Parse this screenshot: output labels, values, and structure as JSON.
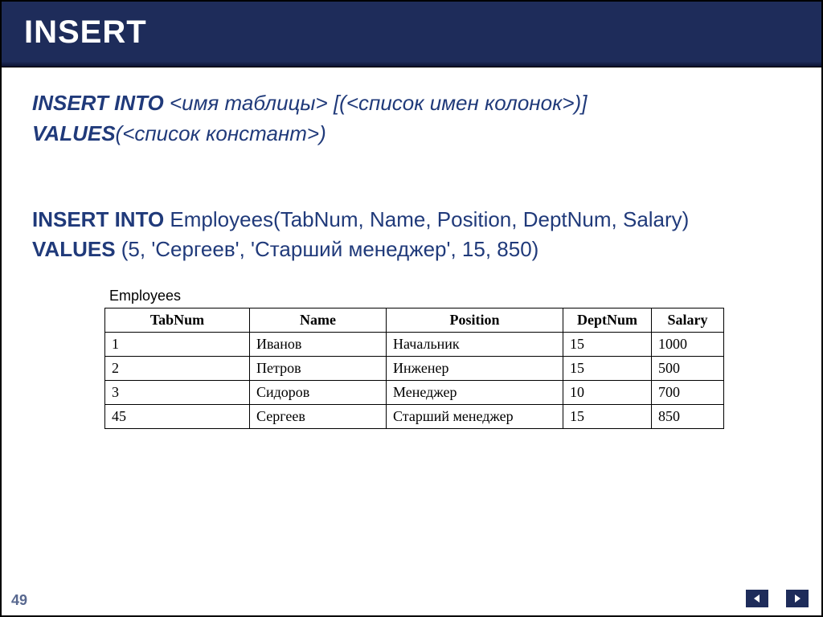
{
  "title": "INSERT",
  "syntax": {
    "kw1": "INSERT INTO",
    "part1": " <имя таблицы> [(<список имен колонок>)]",
    "kw2": "VALUES",
    "part2": "(<список констант>)"
  },
  "example": {
    "kw1": "INSERT INTO",
    "part1": " Employees(TabNum, Name, Position, DeptNum, Salary)",
    "kw2": "VALUES",
    "part2": " (5, 'Сергеев', 'Старший менеджер', 15, 850)"
  },
  "table": {
    "label": "Employees",
    "headers": [
      "TabNum",
      "Name",
      "Position",
      "DeptNum",
      "Salary"
    ],
    "rows": [
      [
        "1",
        "Иванов",
        "Начальник",
        "15",
        "1000"
      ],
      [
        "2",
        "Петров",
        "Инженер",
        "15",
        "500"
      ],
      [
        "3",
        "Сидоров",
        "Менеджер",
        "10",
        "700"
      ],
      [
        "45",
        "Сергеев",
        "Старший менеджер",
        "15",
        "850"
      ]
    ]
  },
  "page_number": "49"
}
